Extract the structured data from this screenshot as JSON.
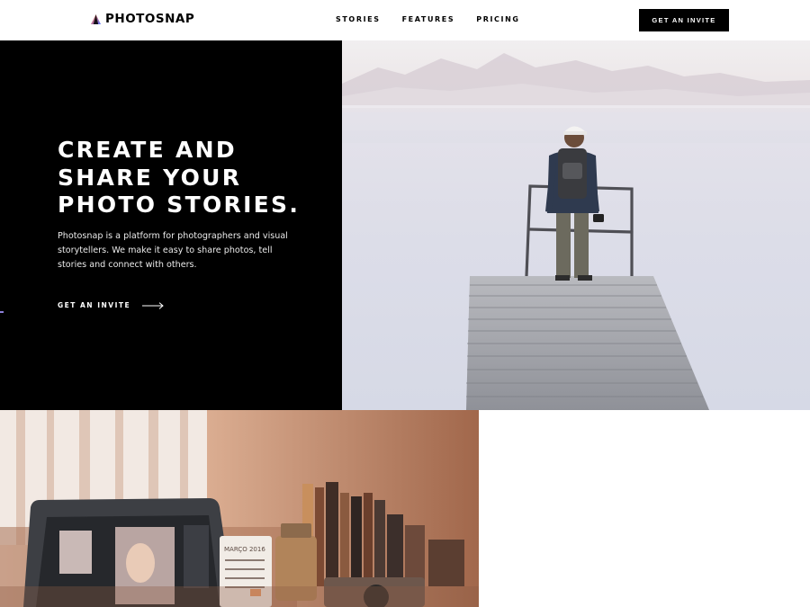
{
  "header": {
    "logo_text": "PHOTOSNAP",
    "nav": [
      "STORIES",
      "FEATURES",
      "PRICING"
    ],
    "cta_label": "GET AN INVITE"
  },
  "hero": {
    "title": "CREATE AND\nSHARE YOUR\nPHOTO STORIES.",
    "description": "Photosnap is a platform for photographers and visual storytellers. We make it easy to share photos, tell stories and connect with others.",
    "cta_label": "GET AN INVITE"
  },
  "feature": {
    "calendar_month": "MARÇO 2016"
  },
  "icons": {
    "logo": "logo-triangle-icon",
    "arrow": "arrow-right-icon"
  },
  "colors": {
    "black": "#000000",
    "white": "#ffffff",
    "accent_gradient": [
      "#FFC593",
      "#BC7198",
      "#5A77FF"
    ]
  }
}
